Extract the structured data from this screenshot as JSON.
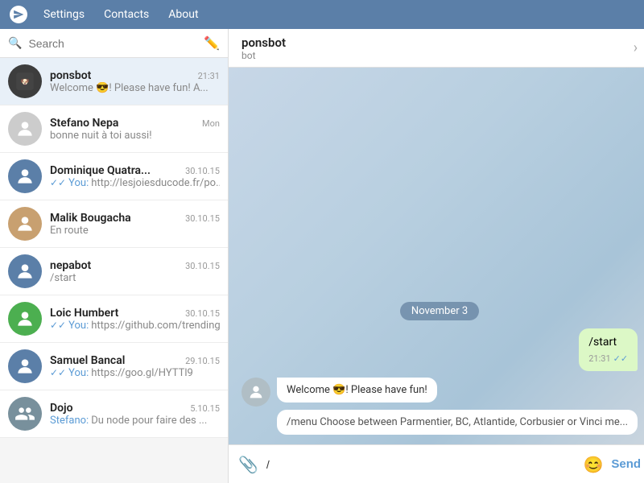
{
  "topbar": {
    "settings_label": "Settings",
    "contacts_label": "Contacts",
    "about_label": "About"
  },
  "sidebar": {
    "search_placeholder": "Search",
    "chats": [
      {
        "id": "ponsbot",
        "name": "ponsbot",
        "time": "21:31",
        "preview": "Welcome 😎! Please have fun! A...",
        "avatar_type": "image",
        "active": true,
        "has_check": false
      },
      {
        "id": "stefano-nepa",
        "name": "Stefano Nepa",
        "time": "Mon",
        "preview": "bonne nuit à toi aussi!",
        "avatar_type": "image",
        "active": false,
        "has_check": false
      },
      {
        "id": "dominique-quatra",
        "name": "Dominique Quatra...",
        "time": "30.10.15",
        "preview": "You: http://lesjoiesducode.fr/po...",
        "avatar_type": "placeholder",
        "avatar_color": "blue",
        "active": false,
        "has_check": true
      },
      {
        "id": "malik-bougacha",
        "name": "Malik Bougacha",
        "time": "30.10.15",
        "preview": "En route",
        "avatar_type": "image",
        "active": false,
        "has_check": false
      },
      {
        "id": "nepabot",
        "name": "nepabot",
        "time": "30.10.15",
        "preview": "/start",
        "avatar_type": "placeholder",
        "avatar_color": "blue",
        "active": false,
        "has_check": false
      },
      {
        "id": "loic-humbert",
        "name": "Loic Humbert",
        "time": "30.10.15",
        "preview": "You: https://github.com/trending",
        "avatar_type": "placeholder",
        "avatar_color": "green",
        "active": false,
        "has_check": true
      },
      {
        "id": "samuel-bancal",
        "name": "Samuel Bancal",
        "time": "29.10.15",
        "preview": "You: https://goo.gl/HYTTl9",
        "avatar_type": "placeholder",
        "avatar_color": "blue",
        "active": false,
        "has_check": true
      },
      {
        "id": "dojo",
        "name": "Dojo",
        "time": "5.10.15",
        "preview": "Stefano: Du node pour faire des ...",
        "avatar_type": "group",
        "active": false,
        "has_check": false
      }
    ]
  },
  "chat": {
    "contact_name": "ponsbot",
    "status": "bot",
    "date_badge": "November 3",
    "messages": [
      {
        "id": "msg-outgoing",
        "text": "/start",
        "time": "21:31",
        "type": "outgoing",
        "has_check": true
      }
    ],
    "bot_welcome": "Welcome 😎! Please have fun!",
    "bot_menu": "/menu   Choose between Parmentier, BC, Atlantide, Corbusier or Vinci me...",
    "input_value": "/",
    "send_label": "Send"
  }
}
